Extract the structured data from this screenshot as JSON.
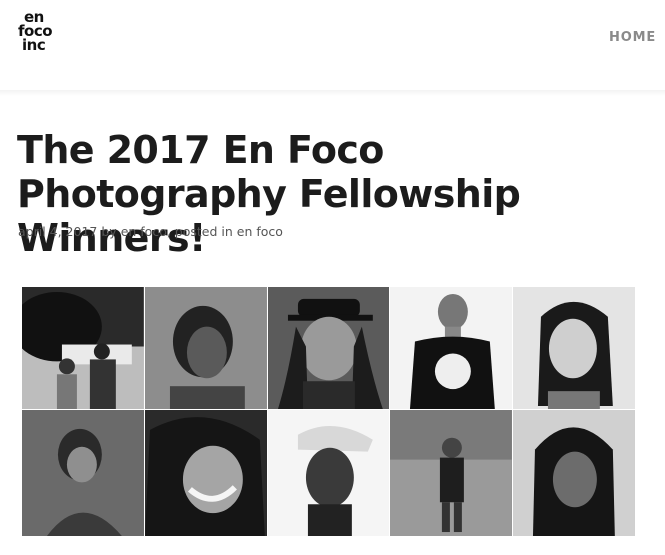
{
  "site": {
    "logo_lines": [
      "en",
      "foco",
      "inc"
    ],
    "nav": {
      "home_label": "HOME"
    }
  },
  "post": {
    "title": "The 2017 En Foco Photography Fellowship Winners!",
    "meta": {
      "date": "april 4, 2017",
      "by_text": "by",
      "author": "en foco",
      "posted_in_text": ", posted in",
      "category": "en foco"
    },
    "image": {
      "description_icon": "photo-collage-icon",
      "tiles": 10
    }
  }
}
